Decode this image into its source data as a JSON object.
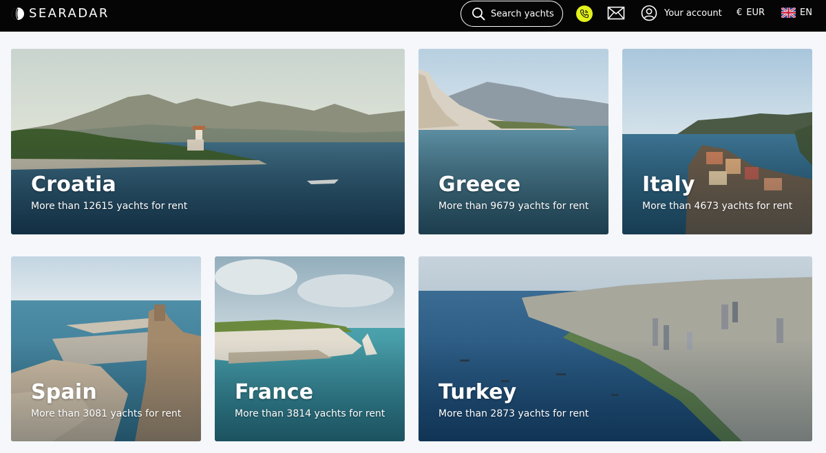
{
  "header": {
    "brand": "SEARADAR",
    "search_label": "Search yachts",
    "account_label": "Your account",
    "currency_symbol": "€",
    "currency": "EUR",
    "language": "EN",
    "accent_color": "#e3f21b",
    "icons": [
      "brand-logo-icon",
      "search-icon",
      "phone-icon",
      "mail-icon",
      "account-icon",
      "uk-flag-icon"
    ]
  },
  "destinations": [
    {
      "name": "Croatia",
      "count_text": "More than 12615 yachts for rent"
    },
    {
      "name": "Greece",
      "count_text": "More than 9679 yachts for rent"
    },
    {
      "name": "Italy",
      "count_text": "More than 4673 yachts for rent"
    },
    {
      "name": "Spain",
      "count_text": "More than 3081 yachts for rent"
    },
    {
      "name": "France",
      "count_text": "More than 3814 yachts for rent"
    },
    {
      "name": "Turkey",
      "count_text": "More than 2873 yachts for rent"
    }
  ]
}
